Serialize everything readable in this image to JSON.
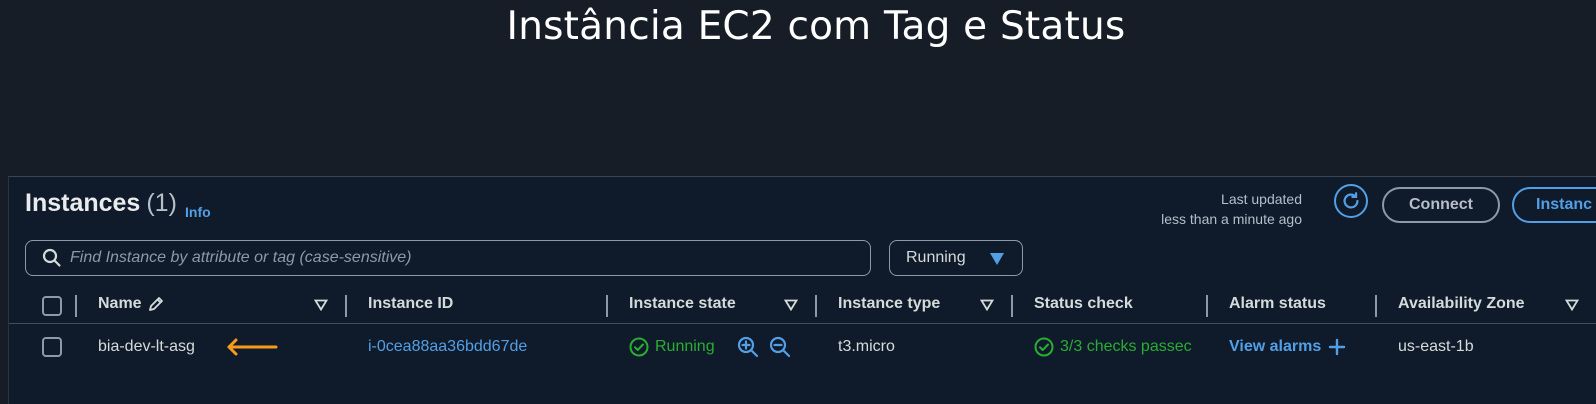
{
  "slide_title": "Instância EC2 com Tag e Status",
  "header": {
    "title": "Instances",
    "count": "(1)",
    "info_link": "Info",
    "last_updated_label": "Last updated",
    "last_updated_value": "less than a minute ago",
    "connect_label": "Connect",
    "instance_state_menu_label": "Instanc"
  },
  "search": {
    "placeholder": "Find Instance by attribute or tag (case-sensitive)"
  },
  "state_filter": {
    "selected": "Running"
  },
  "columns": {
    "name": "Name",
    "instance_id": "Instance ID",
    "instance_state": "Instance state",
    "instance_type": "Instance type",
    "status_check": "Status check",
    "alarm_status": "Alarm status",
    "availability_zone": "Availability Zone"
  },
  "rows": [
    {
      "name": "bia-dev-lt-asg",
      "instance_id": "i-0cea88aa36bdd67de",
      "instance_state": "Running",
      "instance_type": "t3.micro",
      "status_check": "3/3 checks passec",
      "alarm_status": "View alarms",
      "availability_zone": "us-east-1b"
    }
  ],
  "colors": {
    "accent": "#539fe5",
    "success": "#29ad32",
    "annotation_arrow": "#f89b1c",
    "background": "#0f1b2a"
  },
  "icons": [
    "search-icon",
    "refresh-icon",
    "caret-down-icon",
    "pencil-icon",
    "sort-icon",
    "check-circle-icon",
    "zoom-in-icon",
    "zoom-out-icon",
    "plus-icon",
    "arrow-left-icon"
  ]
}
